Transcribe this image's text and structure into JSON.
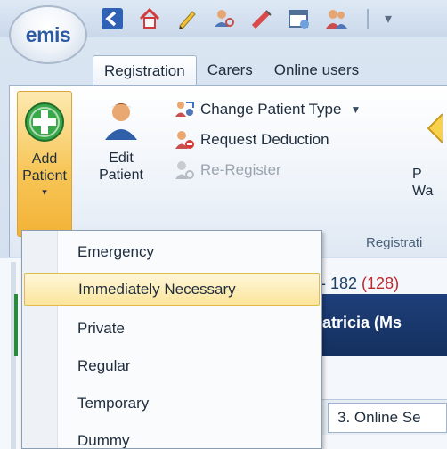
{
  "app": {
    "logo_text": "emis",
    "quick_access_icons": [
      "back-icon",
      "home-icon",
      "edit-pencil-icon",
      "user-search-icon",
      "syringe-icon",
      "calendar-icon",
      "users-icon"
    ]
  },
  "ribbon": {
    "tabs": [
      {
        "label": "Registration",
        "active": true
      },
      {
        "label": "Carers",
        "active": false
      },
      {
        "label": "Online users",
        "active": false
      }
    ],
    "add_patient": {
      "line1": "Add",
      "line2": "Patient",
      "arrow": "▾"
    },
    "edit_patient": {
      "line1": "Edit",
      "line2": "Patient"
    },
    "change_patient_type": "Change Patient Type",
    "request_deduction": "Request Deduction",
    "re_register": "Re-Register",
    "partial_button": {
      "line1": "P",
      "line2": "Wa"
    },
    "group_label": "Registrati"
  },
  "menu": {
    "items": [
      "Emergency",
      "Immediately Necessary",
      "Private",
      "Regular",
      "Temporary",
      "Dummy"
    ],
    "highlighted": "Immediately Necessary"
  },
  "content": {
    "count_prefix": "- 182",
    "count_red": "(128)",
    "patient_name": "Patricia (Ms",
    "tab_label": "3. Online Se"
  },
  "colors": {
    "accent_orange": "#f7c658",
    "navy_bar": "#1e3f7a",
    "red_count": "#c0282d",
    "add_green": "#3aa84a"
  }
}
